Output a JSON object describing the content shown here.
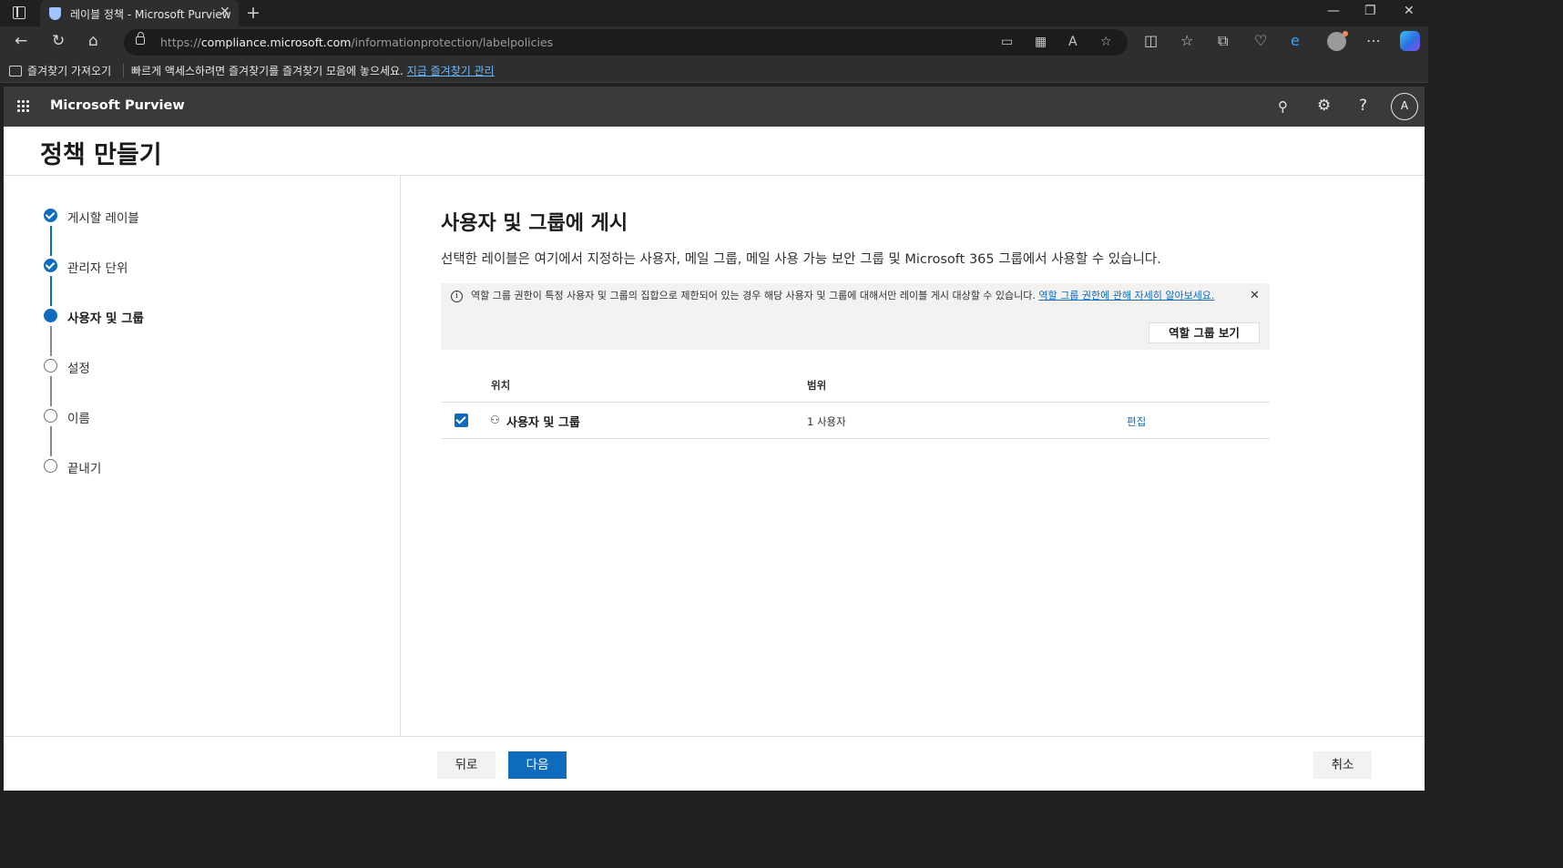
{
  "browser": {
    "tab_title": "레이블 정책 - Microsoft Purview",
    "tab_close": "✕",
    "new_tab": "+",
    "window_controls": {
      "minimize": "—",
      "restore": "❐",
      "close": "✕"
    },
    "url_prefix": "https://",
    "url_domain": "compliance.microsoft.com",
    "url_path": "/informationprotection/labelpolicies",
    "favorites": {
      "import_label": "즐겨찾기 가져오기",
      "message": "빠르게 액세스하려면 즐겨찾기를 즐겨찾기 모음에 놓으세요. ",
      "manage_link": "지금 즐겨찾기 관리"
    },
    "icons": {
      "back": "←",
      "refresh": "↻",
      "home": "⌂",
      "more": "⋯"
    }
  },
  "suite": {
    "brand": "Microsoft Purview",
    "avatar_initial": "A",
    "icons": {
      "settings": "⚙",
      "help": "?"
    }
  },
  "page": {
    "title": "정책 만들기"
  },
  "steps": [
    {
      "label": "게시할 레이블",
      "state": "done"
    },
    {
      "label": "관리자 단위",
      "state": "done"
    },
    {
      "label": "사용자 및 그룹",
      "state": "current"
    },
    {
      "label": "설정",
      "state": "todo"
    },
    {
      "label": "이름",
      "state": "todo"
    },
    {
      "label": "끝내기",
      "state": "todo"
    }
  ],
  "main": {
    "title": "사용자 및 그룹에 게시",
    "description": "선택한 레이블은 여기에서 지정하는 사용자, 메일 그룹, 메일 사용 가능 보안 그룹 및 Microsoft 365 그룹에서 사용할 수 있습니다.",
    "info": {
      "text": "역할 그룹 권한이 특정 사용자 및 그룹의 집합으로 제한되어 있는 경우 해당 사용자 및 그룹에 대해서만 레이블 게시 대상할 수 있습니다. ",
      "link": "역할 그룹 권한에 관해 자세히 알아보세요.",
      "icon": "i",
      "close": "✕",
      "button": "역할 그룹 보기"
    },
    "table": {
      "columns": [
        "위치",
        "범위"
      ],
      "rows": [
        {
          "checked": true,
          "location": "사용자 및 그룹",
          "scope": "1 사용자",
          "action": "편집"
        }
      ]
    }
  },
  "footer": {
    "back": "뒤로",
    "next": "다음",
    "cancel": "취소"
  },
  "colors": {
    "accent": "#0f6cbd",
    "suitebar": "#3b3a39",
    "browser_dark": "#202020"
  }
}
